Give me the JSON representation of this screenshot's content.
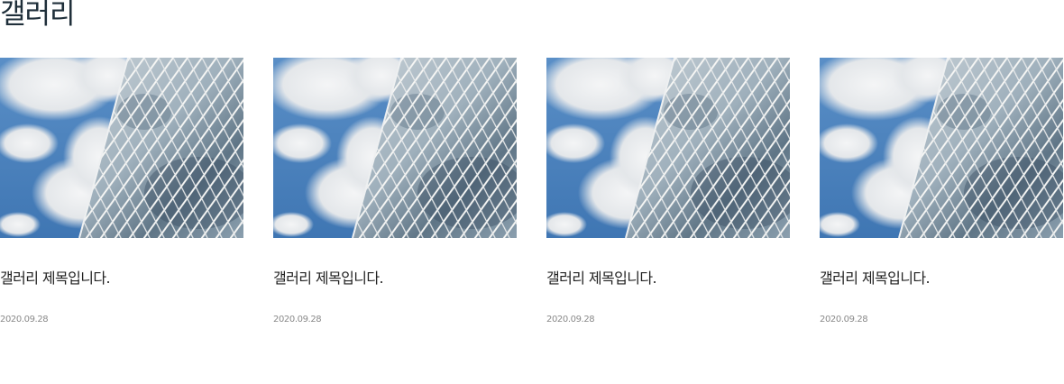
{
  "section": {
    "title": "갤러리"
  },
  "gallery": {
    "items": [
      {
        "title": "갤러리 제목입니다.",
        "date": "2020.09.28",
        "image": "building-sky-photo"
      },
      {
        "title": "갤러리 제목입니다.",
        "date": "2020.09.28",
        "image": "building-sky-photo"
      },
      {
        "title": "갤러리 제목입니다.",
        "date": "2020.09.28",
        "image": "building-sky-photo"
      },
      {
        "title": "갤러리 제목입니다.",
        "date": "2020.09.28",
        "image": "building-sky-photo"
      }
    ]
  },
  "colors": {
    "title_text": "#1f2f3a",
    "card_title": "#222222",
    "date_text": "#8a8a8a",
    "sky": "#4d86c2"
  }
}
